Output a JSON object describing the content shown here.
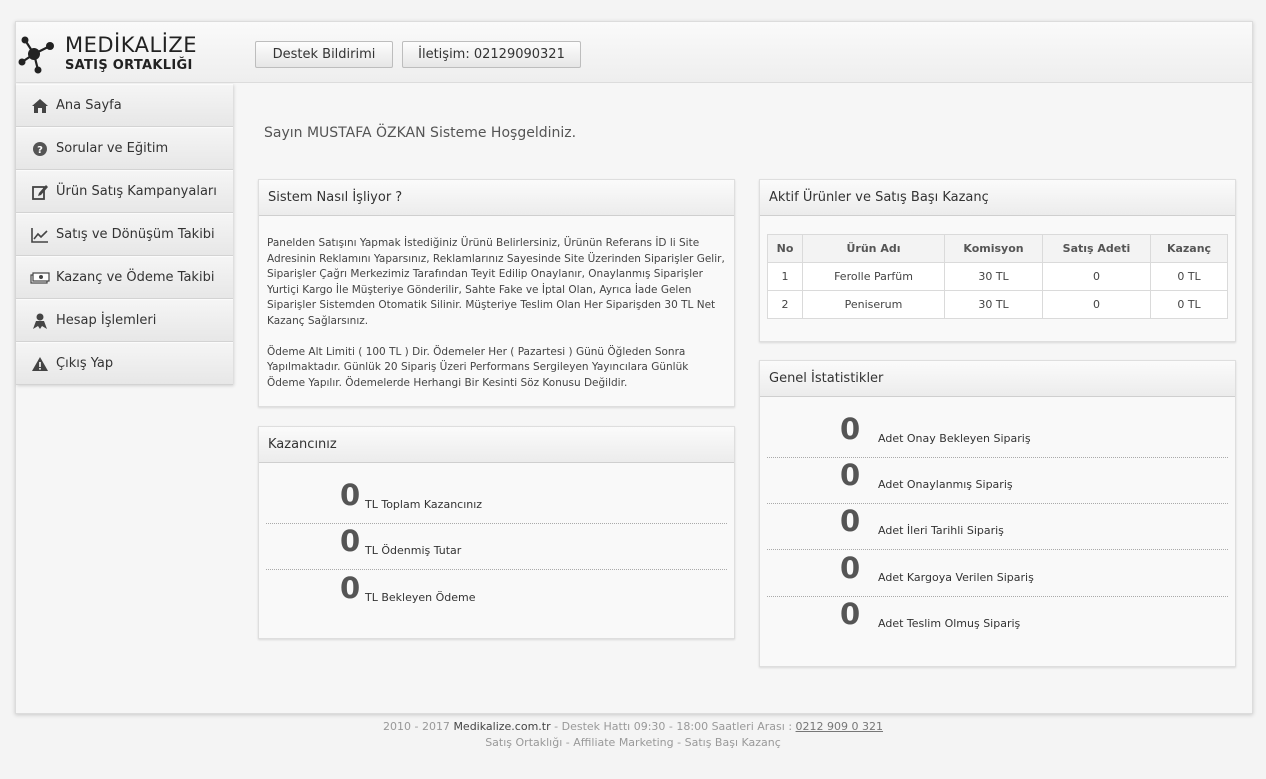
{
  "brand": {
    "title": "MEDİKALİZE",
    "subtitle": "SATIŞ ORTAKLIĞI"
  },
  "header": {
    "support_button": "Destek Bildirimi",
    "contact_button": "İletişim: 02129090321"
  },
  "sidebar": {
    "items": [
      {
        "label": "Ana Sayfa",
        "icon": "home-icon"
      },
      {
        "label": "Sorular ve Eğitim",
        "icon": "question-icon"
      },
      {
        "label": "Ürün Satış Kampanyaları",
        "icon": "edit-icon"
      },
      {
        "label": "Satış ve Dönüşüm Takibi",
        "icon": "chart-icon"
      },
      {
        "label": "Kazanç ve Ödeme Takibi",
        "icon": "money-icon"
      },
      {
        "label": "Hesap İşlemleri",
        "icon": "user-icon"
      },
      {
        "label": "Çıkış Yap",
        "icon": "warning-icon"
      }
    ]
  },
  "welcome": "Sayın MUSTAFA ÖZKAN Sisteme Hoşgeldiniz.",
  "how": {
    "title": "Sistem Nasıl İşliyor ?",
    "p1": "Panelden Satışını Yapmak İstediğiniz Ürünü Belirlersiniz, Ürünün Referans İD li Site Adresinin Reklamını Yaparsınız, Reklamlarınız Sayesinde Site Üzerinden Siparişler Gelir, Siparişler Çağrı Merkezimiz Tarafından Teyit Edilip Onaylanır, Onaylanmış Siparişler Yurtiçi Kargo İle Müşteriye Gönderilir, Sahte Fake ve İptal Olan, Ayrıca İade Gelen Siparişler Sistemden Otomatik Silinir. Müşteriye Teslim Olan Her Siparişden 30 TL Net Kazanç Sağlarsınız.",
    "p2": "Ödeme Alt Limiti ( 100 TL ) Dir. Ödemeler Her ( Pazartesi ) Günü Öğleden Sonra Yapılmaktadır. Günlük 20 Sipariş Üzeri Performans Sergileyen Yayıncılara Günlük Ödeme Yapılır. Ödemelerde Herhangi Bir Kesinti Söz Konusu Değildir."
  },
  "products": {
    "title": "Aktif Ürünler ve Satış Başı Kazanç",
    "columns": [
      "No",
      "Ürün Adı",
      "Komisyon",
      "Satış Adeti",
      "Kazanç"
    ],
    "rows": [
      [
        "1",
        "Ferolle Parfüm",
        "30 TL",
        "0",
        "0 TL"
      ],
      [
        "2",
        "Peniserum",
        "30 TL",
        "0",
        "0 TL"
      ]
    ]
  },
  "earnings": {
    "title": "Kazancınız",
    "items": [
      {
        "value": "0",
        "label": "TL Toplam Kazancınız"
      },
      {
        "value": "0",
        "label": "TL Ödenmiş Tutar"
      },
      {
        "value": "0",
        "label": "TL Bekleyen Ödeme"
      }
    ]
  },
  "stats": {
    "title": "Genel İstatistikler",
    "items": [
      {
        "value": "0",
        "label": "Adet Onay Bekleyen Sipariş"
      },
      {
        "value": "0",
        "label": "Adet Onaylanmış Sipariş"
      },
      {
        "value": "0",
        "label": "Adet İleri Tarihli Sipariş"
      },
      {
        "value": "0",
        "label": "Adet Kargoya Verilen Sipariş"
      },
      {
        "value": "0",
        "label": "Adet Teslim Olmuş Sipariş"
      }
    ]
  },
  "footer": {
    "years": "2010 - 2017",
    "site": "Medikalize.com.tr",
    "hotline": "- Destek Hattı 09:30 - 18:00 Saatleri Arası :",
    "phone": "0212 909 0 321",
    "line2": "Satış Ortaklığı - Affiliate Marketing - Satış Başı Kazanç"
  }
}
